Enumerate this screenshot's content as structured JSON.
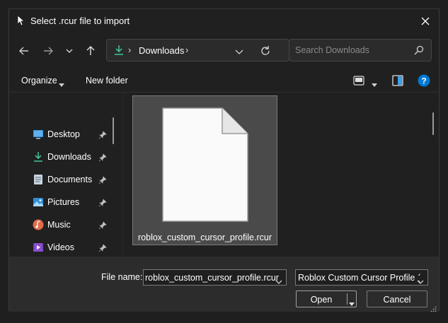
{
  "window": {
    "title": "Select .rcur file to import"
  },
  "nav": {
    "location": "Downloads",
    "search_placeholder": "Search Downloads"
  },
  "commands": {
    "organize": "Organize",
    "new_folder": "New folder"
  },
  "sidebar": {
    "items": [
      {
        "label": "Desktop",
        "icon": "desktop-icon"
      },
      {
        "label": "Downloads",
        "icon": "downloads-icon"
      },
      {
        "label": "Documents",
        "icon": "documents-icon"
      },
      {
        "label": "Pictures",
        "icon": "pictures-icon"
      },
      {
        "label": "Music",
        "icon": "music-icon"
      },
      {
        "label": "Videos",
        "icon": "videos-icon"
      }
    ]
  },
  "files": [
    {
      "name": "roblox_custom_cursor_profile.rcur",
      "selected": true
    }
  ],
  "footer": {
    "file_name_label": "File name:",
    "file_name_value": "roblox_custom_cursor_profile.rcur",
    "file_type": "Roblox Custom Cursor Profile (",
    "open": "Open",
    "cancel": "Cancel"
  },
  "colors": {
    "background": "#202020",
    "accent": "#0078d4",
    "download_green": "#3fbf8f",
    "selection": "#4a4a4a"
  }
}
